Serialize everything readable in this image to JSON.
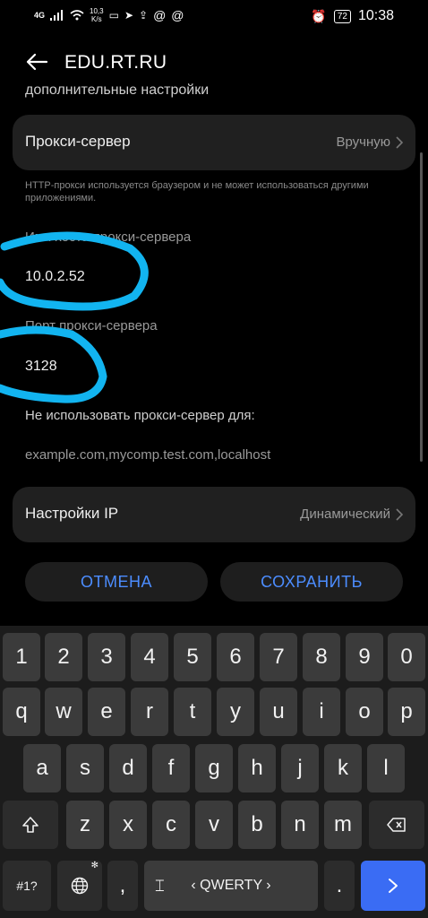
{
  "status_bar": {
    "network": "4G",
    "speed_value": "10,3",
    "speed_unit": "K/s",
    "battery": "72",
    "time": "10:38"
  },
  "header": {
    "title": "EDU.RT.RU"
  },
  "section_heading": "дополнительные настройки",
  "proxy": {
    "label": "Прокси-сервер",
    "value": "Вручную",
    "hint": "HTTP-прокси используется браузером и не может использоваться другими приложениями.",
    "host_label": "Имя хоста прокси-сервера",
    "host_value": "10.0.2.52",
    "port_label": "Порт прокси-сервера",
    "port_value": "3128",
    "bypass_label": "Не использовать прокси-сервер для:",
    "bypass_value": "example.com,mycomp.test.com,localhost"
  },
  "ip_settings": {
    "label": "Настройки IP",
    "value": "Динамический"
  },
  "buttons": {
    "cancel": "ОТМЕНА",
    "save": "СОХРАНИТЬ"
  },
  "keyboard": {
    "row_numbers": [
      "1",
      "2",
      "3",
      "4",
      "5",
      "6",
      "7",
      "8",
      "9",
      "0"
    ],
    "row1": [
      "q",
      "w",
      "e",
      "r",
      "t",
      "y",
      "u",
      "i",
      "o",
      "p"
    ],
    "row2": [
      "a",
      "s",
      "d",
      "f",
      "g",
      "h",
      "j",
      "k",
      "l"
    ],
    "row3": [
      "z",
      "x",
      "c",
      "v",
      "b",
      "n",
      "m"
    ],
    "symbols_key": "#1?",
    "comma_key": ",",
    "space_label": "‹ QWERTY ›",
    "period_key": ".",
    "enter_icon": "arrow-right-icon",
    "shift_icon": "shift-icon",
    "backspace_icon": "backspace-icon",
    "globe_icon": "globe-icon",
    "cursor_icon": "cursor-move-icon"
  },
  "colors": {
    "accent": "#4c8dff",
    "card": "#202020",
    "enter": "#3a6cf4",
    "annotation": "#12b4f0"
  }
}
